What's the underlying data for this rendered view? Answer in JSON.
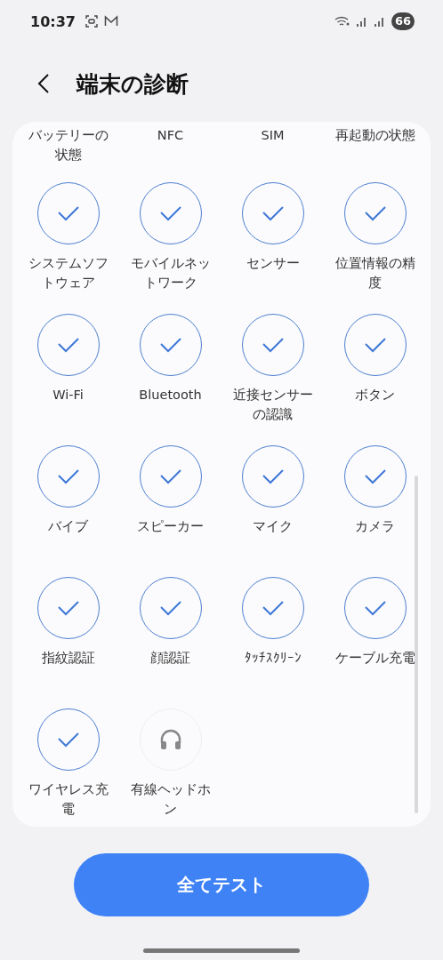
{
  "status_bar": {
    "time": "10:37",
    "battery": "66"
  },
  "header": {
    "title": "端末の診断"
  },
  "scrolled_labels": [
    "バッテリーの状態",
    "NFC",
    "SIM",
    "再起動の状態"
  ],
  "tests": [
    {
      "label": "システムソフトウェア",
      "passed": true
    },
    {
      "label": "モバイルネットワーク",
      "passed": true
    },
    {
      "label": "センサー",
      "passed": true
    },
    {
      "label": "位置情報の精度",
      "passed": true
    },
    {
      "label": "Wi-Fi",
      "passed": true
    },
    {
      "label": "Bluetooth",
      "passed": true
    },
    {
      "label": "近接センサーの認識",
      "passed": true
    },
    {
      "label": "ボタン",
      "passed": true
    },
    {
      "label": "バイブ",
      "passed": true
    },
    {
      "label": "スピーカー",
      "passed": true
    },
    {
      "label": "マイク",
      "passed": true
    },
    {
      "label": "カメラ",
      "passed": true
    },
    {
      "label": "指紋認証",
      "passed": true
    },
    {
      "label": "顔認証",
      "passed": true
    },
    {
      "label": "ﾀｯﾁｽｸﾘｰﾝ",
      "passed": true
    },
    {
      "label": "ケーブル充電",
      "passed": true
    },
    {
      "label": "ワイヤレス充電",
      "passed": true
    },
    {
      "label": "有線ヘッドホン",
      "passed": false
    }
  ],
  "action_button": "全てテスト"
}
